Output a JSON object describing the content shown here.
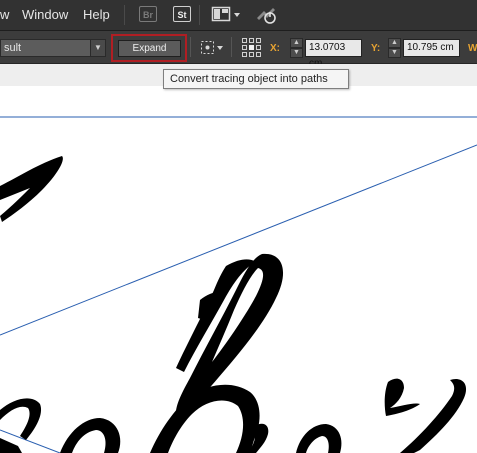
{
  "menubar": {
    "items": [
      {
        "label": "w"
      },
      {
        "label": "Window"
      },
      {
        "label": "Help"
      }
    ],
    "bridge_label": "Br",
    "stock_label": "St",
    "arrange_icon": "arrange-documents-icon",
    "sync_icon": "sync-settings-icon"
  },
  "control": {
    "preset_value": "sult",
    "expand_label": "Expand",
    "x_label": "X:",
    "x_value": "13.0703 cm",
    "y_label": "Y:",
    "y_value": "10.795 cm",
    "w_label": "W"
  },
  "tooltip": {
    "text": "Convert tracing object into paths"
  },
  "colors": {
    "accent_highlight": "#b01e23",
    "guide_blue": "#2a5fb0",
    "label_orange": "#e8a432"
  }
}
